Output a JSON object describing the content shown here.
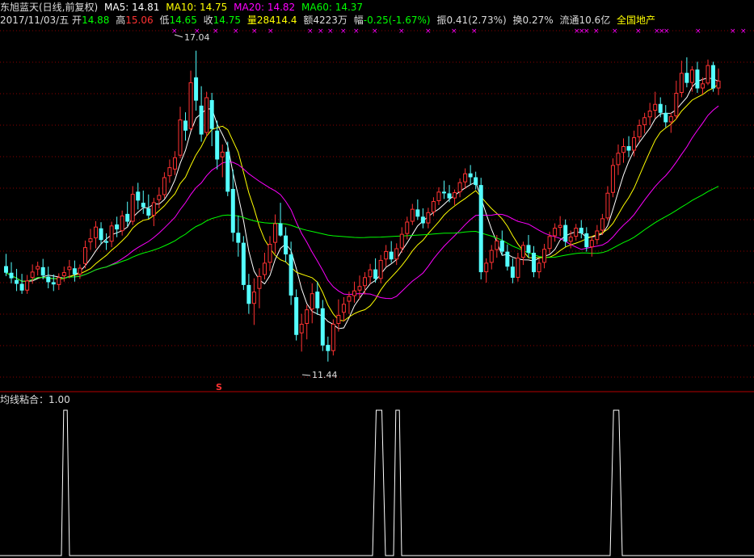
{
  "header": {
    "stock_name": "东旭蓝天(日线,前复权)",
    "ma5": "MA5: 14.81",
    "ma10": "MA10: 14.75",
    "ma20": "MA20: 14.82",
    "ma60": "MA60: 14.37",
    "date": "2017/11/03/五",
    "open_label": "开",
    "open": "14.88",
    "high_label": "高",
    "high": "15.06",
    "low_label": "低",
    "low": "14.65",
    "close_label": "收",
    "close": "14.75",
    "volume_label": "量",
    "volume": "28414.4",
    "amount_label": "额",
    "amount": "4223万",
    "change_label": "幅",
    "change": "-0.25(-1.67%)",
    "amplitude_label": "振",
    "amplitude": "0.41(2.73%)",
    "turnover_label": "换",
    "turnover": "0.27%",
    "float_label": "流通",
    "float": "10.6亿",
    "sector": "全国地产"
  },
  "colors": {
    "up": "#ff3232",
    "down": "#54ffff",
    "ma5": "#ffffff",
    "ma10": "#ffff00",
    "ma20": "#ff00ff",
    "ma60": "#00ff00",
    "grid": "#8b0000",
    "divider": "#b40000",
    "label_white": "#dddddd"
  },
  "chart_data": [
    {
      "type": "candlestick",
      "title": "东旭蓝天(日线,前复权)",
      "ylim": [
        11.0,
        17.4
      ],
      "annotations": {
        "max_label": "17.04",
        "min_label": "11.44",
        "marker": "S"
      },
      "ohlc": [
        [
          13.16,
          13.38,
          12.98,
          13.04
        ],
        [
          13.04,
          13.23,
          12.85,
          12.94
        ],
        [
          12.91,
          13.11,
          12.71,
          12.84
        ],
        [
          12.84,
          13.02,
          12.66,
          12.72
        ],
        [
          12.72,
          13.0,
          12.66,
          12.9
        ],
        [
          12.95,
          13.19,
          12.84,
          13.06
        ],
        [
          13.1,
          13.24,
          12.99,
          13.16
        ],
        [
          13.14,
          13.29,
          12.92,
          12.99
        ],
        [
          12.97,
          13.15,
          12.76,
          12.87
        ],
        [
          12.87,
          13.01,
          12.71,
          12.83
        ],
        [
          12.82,
          13.03,
          12.73,
          12.96
        ],
        [
          12.98,
          13.15,
          12.88,
          13.05
        ],
        [
          13.09,
          13.27,
          12.94,
          13.15
        ],
        [
          13.12,
          13.26,
          12.88,
          13.01
        ],
        [
          13.01,
          13.19,
          12.93,
          13.13
        ],
        [
          13.2,
          13.62,
          13.12,
          13.5
        ],
        [
          13.59,
          13.83,
          13.45,
          13.66
        ],
        [
          13.66,
          13.97,
          13.48,
          13.87
        ],
        [
          13.84,
          13.95,
          13.55,
          13.63
        ],
        [
          13.61,
          13.75,
          13.45,
          13.58
        ],
        [
          13.6,
          13.96,
          13.5,
          13.89
        ],
        [
          13.91,
          14.05,
          13.68,
          13.82
        ],
        [
          13.79,
          14.16,
          13.71,
          14.07
        ],
        [
          14.1,
          14.32,
          13.88,
          13.96
        ],
        [
          13.96,
          14.6,
          13.9,
          14.46
        ],
        [
          14.5,
          14.66,
          14.18,
          14.34
        ],
        [
          14.3,
          14.52,
          14.1,
          14.22
        ],
        [
          14.2,
          14.45,
          14.01,
          14.07
        ],
        [
          14.07,
          14.39,
          13.88,
          14.31
        ],
        [
          14.35,
          14.58,
          14.2,
          14.44
        ],
        [
          14.44,
          14.85,
          14.38,
          14.76
        ],
        [
          14.78,
          15.08,
          14.66,
          14.94
        ],
        [
          14.9,
          15.23,
          14.8,
          15.12
        ],
        [
          15.15,
          16.03,
          15.1,
          15.8
        ],
        [
          15.78,
          15.93,
          15.42,
          15.6
        ],
        [
          15.63,
          16.68,
          15.6,
          16.47
        ],
        [
          16.56,
          17.04,
          15.96,
          16.14
        ],
        [
          16.05,
          16.4,
          15.4,
          15.53
        ],
        [
          15.56,
          16.3,
          15.49,
          16.2
        ],
        [
          16.15,
          16.28,
          15.32,
          15.63
        ],
        [
          15.6,
          15.78,
          14.9,
          15.08
        ],
        [
          15.12,
          15.35,
          14.76,
          15.22
        ],
        [
          15.22,
          15.4,
          14.42,
          14.5
        ],
        [
          14.55,
          14.9,
          13.6,
          13.76
        ],
        [
          13.76,
          14.07,
          13.33,
          13.58
        ],
        [
          13.58,
          13.7,
          12.73,
          12.82
        ],
        [
          12.82,
          13.02,
          12.3,
          12.48
        ],
        [
          12.48,
          12.94,
          12.1,
          12.7
        ],
        [
          12.75,
          13.12,
          12.4,
          12.98
        ],
        [
          13.0,
          13.4,
          12.92,
          13.22
        ],
        [
          13.22,
          13.7,
          13.07,
          13.56
        ],
        [
          13.58,
          14.09,
          13.38,
          13.93
        ],
        [
          13.93,
          14.3,
          13.69,
          13.71
        ],
        [
          13.71,
          13.86,
          13.23,
          13.37
        ],
        [
          13.37,
          13.6,
          12.46,
          12.63
        ],
        [
          12.6,
          12.74,
          11.82,
          11.92
        ],
        [
          11.95,
          12.3,
          11.62,
          12.12
        ],
        [
          12.12,
          12.46,
          11.84,
          12.38
        ],
        [
          12.38,
          12.85,
          12.13,
          12.67
        ],
        [
          12.7,
          12.88,
          12.28,
          12.4
        ],
        [
          12.4,
          12.55,
          11.63,
          11.73
        ],
        [
          11.74,
          11.89,
          11.44,
          11.63
        ],
        [
          11.63,
          12.2,
          11.55,
          12.12
        ],
        [
          12.12,
          12.56,
          11.98,
          12.28
        ],
        [
          12.32,
          12.6,
          12.16,
          12.48
        ],
        [
          12.52,
          12.7,
          12.3,
          12.62
        ],
        [
          12.62,
          12.88,
          12.5,
          12.72
        ],
        [
          12.72,
          12.99,
          12.56,
          12.8
        ],
        [
          12.8,
          13.05,
          12.65,
          12.96
        ],
        [
          12.96,
          13.2,
          12.84,
          13.1
        ],
        [
          13.1,
          13.3,
          12.86,
          12.93
        ],
        [
          12.93,
          13.36,
          12.85,
          13.27
        ],
        [
          13.28,
          13.54,
          13.15,
          13.43
        ],
        [
          13.42,
          13.61,
          13.22,
          13.28
        ],
        [
          13.28,
          13.57,
          13.18,
          13.48
        ],
        [
          13.48,
          13.86,
          13.4,
          13.74
        ],
        [
          13.74,
          14.05,
          13.64,
          13.96
        ],
        [
          13.96,
          14.28,
          13.9,
          14.19
        ],
        [
          14.18,
          14.36,
          13.99,
          14.05
        ],
        [
          14.05,
          14.2,
          13.84,
          13.93
        ],
        [
          13.93,
          14.21,
          13.84,
          14.13
        ],
        [
          14.13,
          14.4,
          14.06,
          14.33
        ],
        [
          14.33,
          14.58,
          14.26,
          14.5
        ],
        [
          14.5,
          14.7,
          14.37,
          14.47
        ],
        [
          14.47,
          14.62,
          14.31,
          14.38
        ],
        [
          14.38,
          14.54,
          14.26,
          14.49
        ],
        [
          14.49,
          14.74,
          14.4,
          14.67
        ],
        [
          14.67,
          14.92,
          14.55,
          14.83
        ],
        [
          14.83,
          14.98,
          14.63,
          14.76
        ],
        [
          14.76,
          14.86,
          14.54,
          14.62
        ],
        [
          14.62,
          14.75,
          12.92,
          13.05
        ],
        [
          13.05,
          13.3,
          12.86,
          13.22
        ],
        [
          13.22,
          13.54,
          13.1,
          13.45
        ],
        [
          13.45,
          13.72,
          13.31,
          13.62
        ],
        [
          13.62,
          13.8,
          13.35,
          13.42
        ],
        [
          13.42,
          13.55,
          13.08,
          13.15
        ],
        [
          13.15,
          13.3,
          12.85,
          12.95
        ],
        [
          12.95,
          13.4,
          12.88,
          13.31
        ],
        [
          13.31,
          13.6,
          13.18,
          13.54
        ],
        [
          13.54,
          13.72,
          13.31,
          13.4
        ],
        [
          13.4,
          13.52,
          12.96,
          13.05
        ],
        [
          13.05,
          13.3,
          12.94,
          13.22
        ],
        [
          13.22,
          13.56,
          13.12,
          13.47
        ],
        [
          13.47,
          13.78,
          13.38,
          13.7
        ],
        [
          13.7,
          13.93,
          13.6,
          13.85
        ],
        [
          13.85,
          14.06,
          13.7,
          13.9
        ],
        [
          13.9,
          14.0,
          13.51,
          13.6
        ],
        [
          13.6,
          13.8,
          13.48,
          13.69
        ],
        [
          13.69,
          13.92,
          13.62,
          13.85
        ],
        [
          13.85,
          13.99,
          13.66,
          13.75
        ],
        [
          13.75,
          13.86,
          13.42,
          13.5
        ],
        [
          13.5,
          13.7,
          13.33,
          13.63
        ],
        [
          13.63,
          13.9,
          13.55,
          13.8
        ],
        [
          13.8,
          14.1,
          13.72,
          14.02
        ],
        [
          14.02,
          14.6,
          13.98,
          14.48
        ],
        [
          14.48,
          15.1,
          14.4,
          14.98
        ],
        [
          14.98,
          15.35,
          14.8,
          15.2
        ],
        [
          15.2,
          15.46,
          15.02,
          15.32
        ],
        [
          15.32,
          15.5,
          15.12,
          15.24
        ],
        [
          15.24,
          15.6,
          15.14,
          15.48
        ],
        [
          15.48,
          15.8,
          15.4,
          15.7
        ],
        [
          15.7,
          15.92,
          15.55,
          15.84
        ],
        [
          15.84,
          16.1,
          15.7,
          15.96
        ],
        [
          15.96,
          16.3,
          15.82,
          16.08
        ],
        [
          16.08,
          16.2,
          15.84,
          15.92
        ],
        [
          15.92,
          16.06,
          15.66,
          15.75
        ],
        [
          15.75,
          15.92,
          15.56,
          15.86
        ],
        [
          15.86,
          16.5,
          15.8,
          16.28
        ],
        [
          16.28,
          16.86,
          16.2,
          16.64
        ],
        [
          16.64,
          16.92,
          16.38,
          16.46
        ],
        [
          16.46,
          16.76,
          16.3,
          16.7
        ],
        [
          16.7,
          16.84,
          16.28,
          16.36
        ],
        [
          16.36,
          16.56,
          16.25,
          16.45
        ],
        [
          16.45,
          16.88,
          16.42,
          16.78
        ],
        [
          16.78,
          16.84,
          16.3,
          16.36
        ],
        [
          16.36,
          16.72,
          16.24,
          16.5
        ]
      ]
    },
    {
      "type": "line",
      "title": "均线粘合",
      "value_label": "1.00",
      "ylim": [
        0,
        1
      ],
      "pulses": [
        {
          "start": 76,
          "end": 86
        },
        {
          "start": 461,
          "end": 477
        },
        {
          "start": 487,
          "end": 497
        },
        {
          "start": 755,
          "end": 770
        }
      ]
    }
  ]
}
